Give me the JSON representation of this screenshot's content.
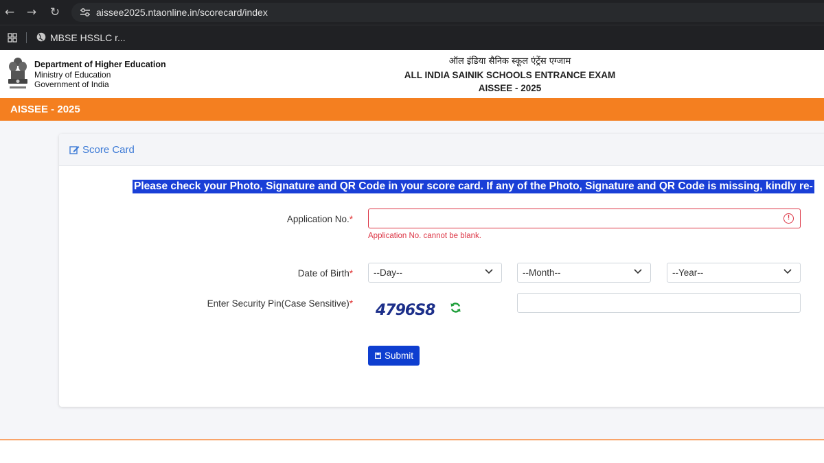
{
  "browser": {
    "url": "aissee2025.ntaonline.in/scorecard/index",
    "bookmark_label": "MBSE HSSLC r..."
  },
  "header": {
    "dept_title": "Department of Higher Education",
    "dept_line2": "Ministry of Education",
    "dept_line3": "Government of India",
    "exam_hindi": "ऑल इंडिया सैनिक स्कूल एंट्रेंस एग्जाम",
    "exam_name": "ALL INDIA SAINIK SCHOOLS ENTRANCE EXAM",
    "exam_year": "AISSEE - 2025"
  },
  "banner": {
    "title": "AISSEE - 2025"
  },
  "card": {
    "title": "Score Card",
    "notice": "Please check your Photo, Signature and QR Code in your score card. If any of the Photo, Signature and QR Code is missing, kindly re-"
  },
  "form": {
    "application_label": "Application No.",
    "application_value": "",
    "application_error": "Application No. cannot be blank.",
    "dob_label": "Date of Birth",
    "day_selected": "--Day--",
    "month_selected": "--Month--",
    "year_selected": "--Year--",
    "pin_label": "Enter Security Pin(Case Sensitive)",
    "captcha_text": "4796S8",
    "pin_value": "",
    "required_mark": "*",
    "submit_label": "Submit"
  },
  "colors": {
    "orange": "#f47f20",
    "primary": "#0e3ed0",
    "error": "#dc3545",
    "refresh": "#1e9e3a"
  }
}
